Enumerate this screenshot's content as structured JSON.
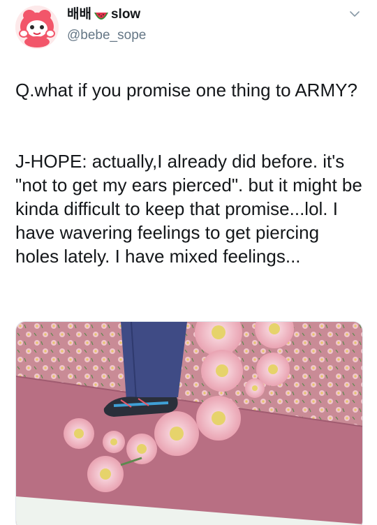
{
  "tweet": {
    "display_name": "배배",
    "display_name_suffix": "slow",
    "handle": "@bebe_sope",
    "paragraph_1": "Q.what if you promise one thing to ARMY?",
    "paragraph_2": "J-HOPE: actually,I already did before. it's \"not to get my ears pierced\". but it might be kinda difficult to keep that promise...lol.  I have wavering feelings to get piercing holes lately. I have mixed feelings...",
    "icons": {
      "watermelon": "watermelon-icon",
      "menu": "chevron-down-icon"
    },
    "colors": {
      "handle": "#657786",
      "text": "#14171a",
      "watermelon_red": "#e0334b",
      "watermelon_green": "#3a8f3a"
    }
  }
}
